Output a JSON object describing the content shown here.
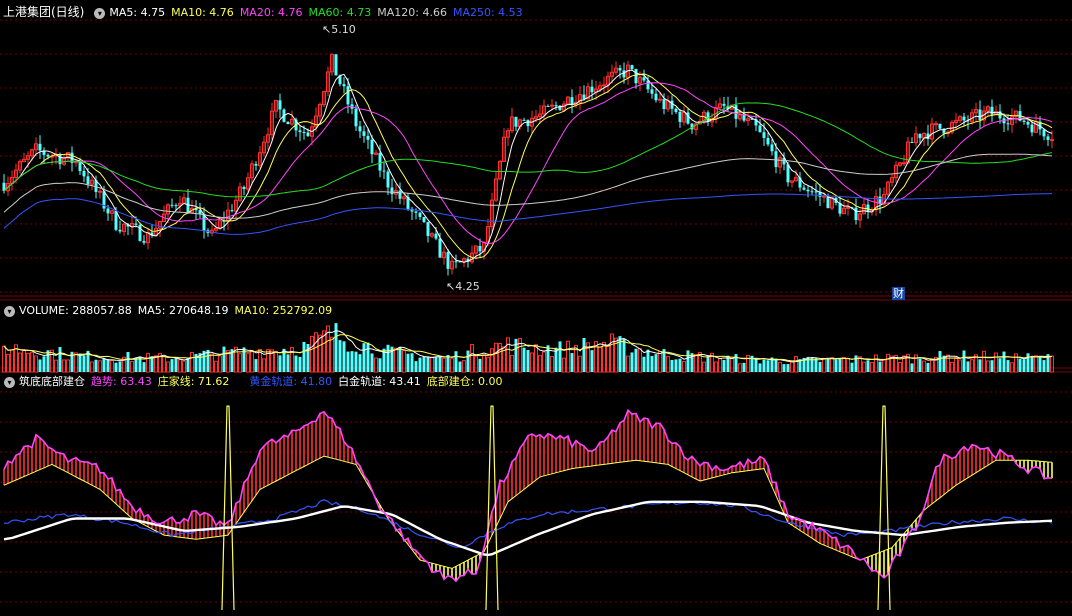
{
  "header": {
    "stock_title": "上港集团(日线)",
    "ma5": "MA5: 4.75",
    "ma10": "MA10: 4.76",
    "ma20": "MA20: 4.76",
    "ma60": "MA60: 4.73",
    "ma120": "MA120: 4.66",
    "ma250": "MA250: 4.53"
  },
  "volume_header": {
    "volume": "VOLUME: 288057.88",
    "ma5": "MA5: 270648.19",
    "ma10": "MA10: 252792.09"
  },
  "indicator_header": {
    "name": "筑底底部建仓",
    "trend": "趋势: 63.43",
    "dealer": "庄家线: 71.62",
    "gold": "黄金轨道: 41.80",
    "platinum": "白金轨道: 43.41",
    "bottom": "底部建仓: 0.00"
  },
  "annotations": {
    "high": "5.10",
    "low": "4.25",
    "cai": "财"
  },
  "colors": {
    "up": "#ff3030",
    "down": "#54ffff",
    "ma5": "#ffffff",
    "ma10": "#ffff55",
    "ma20": "#ff44ff",
    "ma60": "#22dd22",
    "ma120": "#cccccc",
    "ma250": "#3355ff",
    "grid": "#7a0000",
    "trend": "#ff44ff",
    "dealer": "#ffff55",
    "gold": "#3355ff",
    "platinum": "#ffffff"
  },
  "chart_data": [
    {
      "type": "candlestick",
      "title": "上港集团(日线)",
      "ylim": [
        4.2,
        5.2
      ],
      "annotations": [
        {
          "label": "5.10",
          "value": 5.1
        },
        {
          "label": "4.25",
          "value": 4.25
        }
      ],
      "ohlc_anchors": [
        [
          0,
          4.6
        ],
        [
          8,
          4.72
        ],
        [
          18,
          4.68
        ],
        [
          28,
          4.45
        ],
        [
          36,
          4.4
        ],
        [
          44,
          4.55
        ],
        [
          52,
          4.4
        ],
        [
          60,
          4.58
        ],
        [
          68,
          4.88
        ],
        [
          76,
          4.78
        ],
        [
          82,
          5.05
        ],
        [
          88,
          4.82
        ],
        [
          96,
          4.6
        ],
        [
          104,
          4.45
        ],
        [
          112,
          4.28
        ],
        [
          120,
          4.36
        ],
        [
          126,
          4.82
        ],
        [
          134,
          4.85
        ],
        [
          142,
          4.92
        ],
        [
          150,
          4.98
        ],
        [
          156,
          5.02
        ],
        [
          164,
          4.9
        ],
        [
          172,
          4.82
        ],
        [
          180,
          4.88
        ],
        [
          188,
          4.8
        ],
        [
          196,
          4.62
        ],
        [
          204,
          4.55
        ],
        [
          212,
          4.48
        ],
        [
          220,
          4.55
        ],
        [
          228,
          4.78
        ],
        [
          238,
          4.82
        ],
        [
          246,
          4.86
        ],
        [
          254,
          4.84
        ],
        [
          262,
          4.78
        ]
      ]
    },
    {
      "type": "bar",
      "title": "VOLUME",
      "values_note": "daily volume bars",
      "volume_anchors": [
        [
          0,
          0.55
        ],
        [
          20,
          0.35
        ],
        [
          40,
          0.3
        ],
        [
          60,
          0.45
        ],
        [
          75,
          0.55
        ],
        [
          82,
          0.85
        ],
        [
          95,
          0.45
        ],
        [
          110,
          0.3
        ],
        [
          125,
          0.6
        ],
        [
          140,
          0.5
        ],
        [
          150,
          0.65
        ],
        [
          165,
          0.4
        ],
        [
          180,
          0.3
        ],
        [
          200,
          0.25
        ],
        [
          220,
          0.3
        ],
        [
          240,
          0.35
        ],
        [
          262,
          0.3
        ]
      ]
    },
    {
      "type": "line",
      "title": "筑底底部建仓",
      "ylim": [
        0,
        100
      ],
      "series": [
        {
          "name": "趋势",
          "anchors": [
            [
              0,
              70
            ],
            [
              8,
              82
            ],
            [
              16,
              72
            ],
            [
              24,
              68
            ],
            [
              32,
              50
            ],
            [
              40,
              42
            ],
            [
              48,
              46
            ],
            [
              56,
              40
            ],
            [
              64,
              78
            ],
            [
              72,
              84
            ],
            [
              80,
              96
            ],
            [
              86,
              80
            ],
            [
              94,
              50
            ],
            [
              102,
              30
            ],
            [
              110,
              15
            ],
            [
              118,
              18
            ],
            [
              124,
              60
            ],
            [
              132,
              85
            ],
            [
              140,
              82
            ],
            [
              148,
              76
            ],
            [
              156,
              94
            ],
            [
              164,
              88
            ],
            [
              172,
              72
            ],
            [
              180,
              68
            ],
            [
              190,
              72
            ],
            [
              196,
              46
            ],
            [
              204,
              38
            ],
            [
              212,
              28
            ],
            [
              220,
              15
            ],
            [
              228,
              40
            ],
            [
              234,
              72
            ],
            [
              242,
              80
            ],
            [
              250,
              74
            ],
            [
              256,
              68
            ],
            [
              262,
              63
            ]
          ]
        },
        {
          "name": "庄家线",
          "anchors": [
            [
              0,
              60
            ],
            [
              12,
              70
            ],
            [
              24,
              58
            ],
            [
              32,
              44
            ],
            [
              40,
              36
            ],
            [
              48,
              34
            ],
            [
              56,
              36
            ],
            [
              64,
              58
            ],
            [
              72,
              66
            ],
            [
              80,
              74
            ],
            [
              88,
              70
            ],
            [
              96,
              44
            ],
            [
              104,
              24
            ],
            [
              112,
              20
            ],
            [
              120,
              28
            ],
            [
              126,
              52
            ],
            [
              134,
              64
            ],
            [
              142,
              68
            ],
            [
              150,
              70
            ],
            [
              158,
              72
            ],
            [
              166,
              70
            ],
            [
              174,
              62
            ],
            [
              182,
              66
            ],
            [
              190,
              68
            ],
            [
              196,
              42
            ],
            [
              204,
              32
            ],
            [
              214,
              24
            ],
            [
              222,
              30
            ],
            [
              230,
              48
            ],
            [
              238,
              60
            ],
            [
              248,
              72
            ],
            [
              256,
              72
            ],
            [
              262,
              71
            ]
          ]
        },
        {
          "name": "黄金轨道",
          "anchors": [
            [
              0,
              42
            ],
            [
              16,
              46
            ],
            [
              30,
              42
            ],
            [
              42,
              36
            ],
            [
              56,
              40
            ],
            [
              68,
              44
            ],
            [
              80,
              52
            ],
            [
              90,
              48
            ],
            [
              102,
              38
            ],
            [
              114,
              30
            ],
            [
              124,
              40
            ],
            [
              134,
              46
            ],
            [
              146,
              48
            ],
            [
              158,
              50
            ],
            [
              172,
              52
            ],
            [
              184,
              50
            ],
            [
              196,
              42
            ],
            [
              210,
              36
            ],
            [
              222,
              38
            ],
            [
              236,
              42
            ],
            [
              250,
              44
            ],
            [
              262,
              42
            ]
          ]
        },
        {
          "name": "白金轨道",
          "anchors": [
            [
              0,
              34
            ],
            [
              16,
              44
            ],
            [
              30,
              44
            ],
            [
              44,
              38
            ],
            [
              58,
              40
            ],
            [
              72,
              44
            ],
            [
              84,
              50
            ],
            [
              96,
              46
            ],
            [
              108,
              34
            ],
            [
              120,
              26
            ],
            [
              132,
              36
            ],
            [
              146,
              46
            ],
            [
              160,
              52
            ],
            [
              174,
              52
            ],
            [
              188,
              50
            ],
            [
              200,
              42
            ],
            [
              212,
              38
            ],
            [
              224,
              36
            ],
            [
              238,
              40
            ],
            [
              250,
              42
            ],
            [
              262,
              43
            ]
          ]
        },
        {
          "name": "底部建仓",
          "spikes": [
            [
              56,
              98
            ],
            [
              122,
              98
            ],
            [
              220,
              98
            ]
          ]
        }
      ]
    }
  ]
}
